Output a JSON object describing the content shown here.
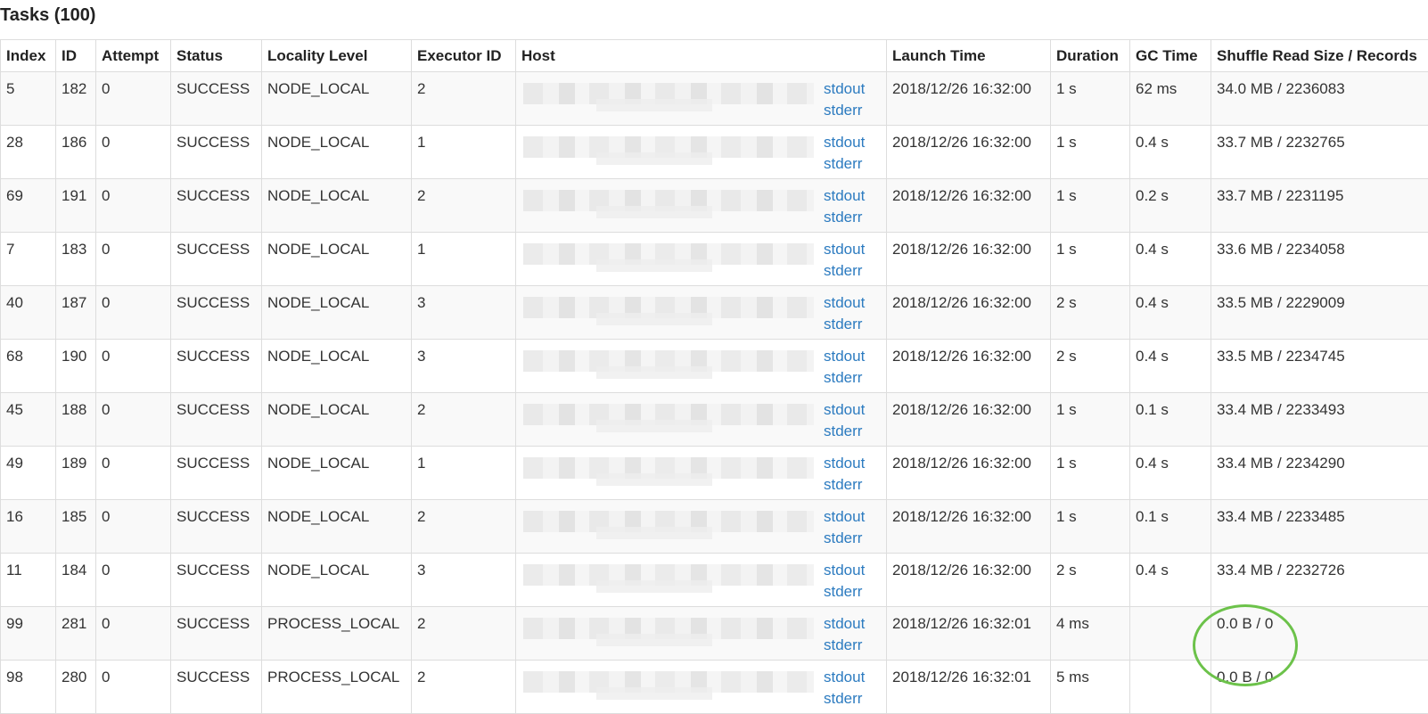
{
  "title": "Tasks (100)",
  "columns": [
    "Index",
    "ID",
    "Attempt",
    "Status",
    "Locality Level",
    "Executor ID",
    "Host",
    "Launch Time",
    "Duration",
    "GC Time",
    "Shuffle Read Size / Records"
  ],
  "rows": [
    {
      "index": "5",
      "id": "182",
      "attempt": "0",
      "status": "SUCCESS",
      "locality": "NODE_LOCAL",
      "executor": "2",
      "stdout": "stdout",
      "stderr": "stderr",
      "launch": "2018/12/26 16:32:00",
      "duration": "1 s",
      "gc": "62 ms",
      "shuffle": "34.0 MB / 2236083"
    },
    {
      "index": "28",
      "id": "186",
      "attempt": "0",
      "status": "SUCCESS",
      "locality": "NODE_LOCAL",
      "executor": "1",
      "stdout": "stdout",
      "stderr": "stderr",
      "launch": "2018/12/26 16:32:00",
      "duration": "1 s",
      "gc": "0.4 s",
      "shuffle": "33.7 MB / 2232765"
    },
    {
      "index": "69",
      "id": "191",
      "attempt": "0",
      "status": "SUCCESS",
      "locality": "NODE_LOCAL",
      "executor": "2",
      "stdout": "stdout",
      "stderr": "stderr",
      "launch": "2018/12/26 16:32:00",
      "duration": "1 s",
      "gc": "0.2 s",
      "shuffle": "33.7 MB / 2231195"
    },
    {
      "index": "7",
      "id": "183",
      "attempt": "0",
      "status": "SUCCESS",
      "locality": "NODE_LOCAL",
      "executor": "1",
      "stdout": "stdout",
      "stderr": "stderr",
      "launch": "2018/12/26 16:32:00",
      "duration": "1 s",
      "gc": "0.4 s",
      "shuffle": "33.6 MB / 2234058"
    },
    {
      "index": "40",
      "id": "187",
      "attempt": "0",
      "status": "SUCCESS",
      "locality": "NODE_LOCAL",
      "executor": "3",
      "stdout": "stdout",
      "stderr": "stderr",
      "launch": "2018/12/26 16:32:00",
      "duration": "2 s",
      "gc": "0.4 s",
      "shuffle": "33.5 MB / 2229009"
    },
    {
      "index": "68",
      "id": "190",
      "attempt": "0",
      "status": "SUCCESS",
      "locality": "NODE_LOCAL",
      "executor": "3",
      "stdout": "stdout",
      "stderr": "stderr",
      "launch": "2018/12/26 16:32:00",
      "duration": "2 s",
      "gc": "0.4 s",
      "shuffle": "33.5 MB / 2234745"
    },
    {
      "index": "45",
      "id": "188",
      "attempt": "0",
      "status": "SUCCESS",
      "locality": "NODE_LOCAL",
      "executor": "2",
      "stdout": "stdout",
      "stderr": "stderr",
      "launch": "2018/12/26 16:32:00",
      "duration": "1 s",
      "gc": "0.1 s",
      "shuffle": "33.4 MB / 2233493"
    },
    {
      "index": "49",
      "id": "189",
      "attempt": "0",
      "status": "SUCCESS",
      "locality": "NODE_LOCAL",
      "executor": "1",
      "stdout": "stdout",
      "stderr": "stderr",
      "launch": "2018/12/26 16:32:00",
      "duration": "1 s",
      "gc": "0.4 s",
      "shuffle": "33.4 MB / 2234290"
    },
    {
      "index": "16",
      "id": "185",
      "attempt": "0",
      "status": "SUCCESS",
      "locality": "NODE_LOCAL",
      "executor": "2",
      "stdout": "stdout",
      "stderr": "stderr",
      "launch": "2018/12/26 16:32:00",
      "duration": "1 s",
      "gc": "0.1 s",
      "shuffle": "33.4 MB / 2233485"
    },
    {
      "index": "11",
      "id": "184",
      "attempt": "0",
      "status": "SUCCESS",
      "locality": "NODE_LOCAL",
      "executor": "3",
      "stdout": "stdout",
      "stderr": "stderr",
      "launch": "2018/12/26 16:32:00",
      "duration": "2 s",
      "gc": "0.4 s",
      "shuffle": "33.4 MB / 2232726"
    },
    {
      "index": "99",
      "id": "281",
      "attempt": "0",
      "status": "SUCCESS",
      "locality": "PROCESS_LOCAL",
      "executor": "2",
      "stdout": "stdout",
      "stderr": "stderr",
      "launch": "2018/12/26 16:32:01",
      "duration": "4 ms",
      "gc": "",
      "shuffle": "0.0 B / 0"
    },
    {
      "index": "98",
      "id": "280",
      "attempt": "0",
      "status": "SUCCESS",
      "locality": "PROCESS_LOCAL",
      "executor": "2",
      "stdout": "stdout",
      "stderr": "stderr",
      "launch": "2018/12/26 16:32:01",
      "duration": "5 ms",
      "gc": "",
      "shuffle": "0.0 B / 0"
    }
  ],
  "colors": {
    "link": "#2c7bc0",
    "highlight_circle": "#6cc24a",
    "stripe": "#f9f9f9",
    "border": "#dddddd"
  }
}
